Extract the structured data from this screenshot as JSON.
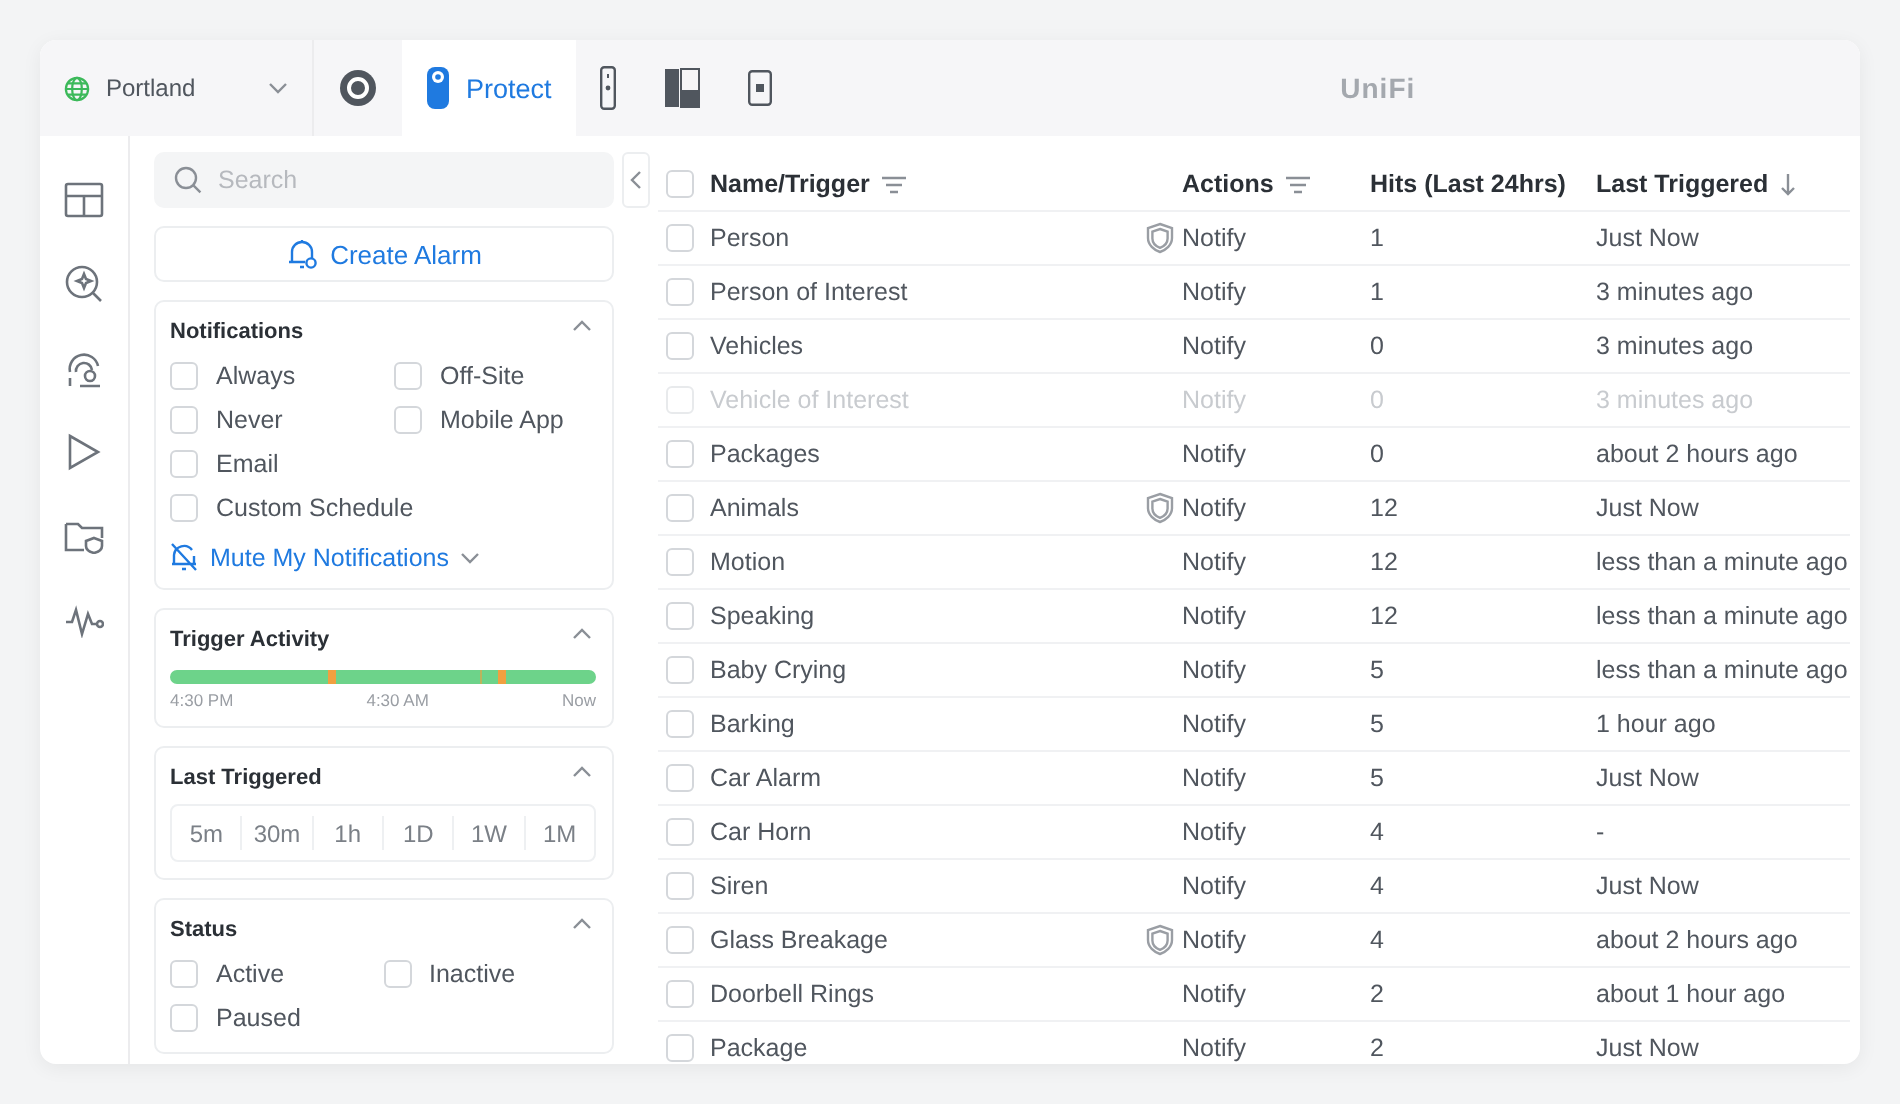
{
  "site_selector": {
    "label": "Portland"
  },
  "apps": [
    {
      "selected": false
    },
    {
      "label": "Protect",
      "selected": true
    },
    {
      "selected": false
    },
    {
      "selected": false
    },
    {
      "selected": false
    }
  ],
  "brand": "UniFi",
  "nav": [
    {
      "selected": false
    },
    {
      "selected": false
    },
    {
      "selected": false
    },
    {
      "selected": false
    },
    {
      "selected": false
    },
    {
      "selected": false
    }
  ],
  "filters": {
    "search": {
      "placeholder": "Search"
    },
    "create_button": "Create Alarm",
    "notifications": {
      "title": "Notifications",
      "expanded": true,
      "columns": [
        [
          {
            "label": "Always",
            "checked": false
          },
          {
            "label": "Never",
            "checked": false
          },
          {
            "label": "Email",
            "checked": false
          },
          {
            "label": "Custom Schedule",
            "checked": false
          }
        ],
        [
          {
            "label": "Off-Site",
            "checked": false
          },
          {
            "label": "Mobile App",
            "checked": false
          }
        ]
      ],
      "mute_link": "Mute My Notifications"
    },
    "trigger_activity": {
      "title": "Trigger Activity",
      "expanded": true,
      "labels": [
        "4:30 PM",
        "4:30 AM",
        "Now"
      ]
    },
    "last_triggered": {
      "title": "Last Triggered",
      "expanded": true,
      "options": [
        {
          "label": "5m",
          "selected": false
        },
        {
          "label": "30m",
          "selected": false
        },
        {
          "label": "1h",
          "selected": false
        },
        {
          "label": "1D",
          "selected": false
        },
        {
          "label": "1W",
          "selected": false
        },
        {
          "label": "1M",
          "selected": false
        }
      ]
    },
    "status": {
      "title": "Status",
      "expanded": true,
      "columns": [
        [
          {
            "label": "Active",
            "checked": false
          },
          {
            "label": "Paused",
            "checked": false
          }
        ],
        [
          {
            "label": "Inactive",
            "checked": false
          }
        ]
      ]
    }
  },
  "table": {
    "select_all_checked": false,
    "columns": [
      "Name/Trigger",
      "Actions",
      "Hits (Last 24hrs)",
      "Last Triggered"
    ],
    "rows": [
      {
        "name": "Person",
        "shield": true,
        "action": "Notify",
        "hits": "1",
        "last": "Just Now",
        "disabled": false,
        "checked": false
      },
      {
        "name": "Person of Interest",
        "shield": false,
        "action": "Notify",
        "hits": "1",
        "last": "3 minutes ago",
        "disabled": false,
        "checked": false
      },
      {
        "name": "Vehicles",
        "shield": false,
        "action": "Notify",
        "hits": "0",
        "last": "3 minutes ago",
        "disabled": false,
        "checked": false
      },
      {
        "name": "Vehicle of Interest",
        "shield": false,
        "action": "Notify",
        "hits": "0",
        "last": "3 minutes ago",
        "disabled": true,
        "checked": false
      },
      {
        "name": "Packages",
        "shield": false,
        "action": "Notify",
        "hits": "0",
        "last": "about 2 hours ago",
        "disabled": false,
        "checked": false
      },
      {
        "name": "Animals",
        "shield": true,
        "action": "Notify",
        "hits": "12",
        "last": "Just Now",
        "disabled": false,
        "checked": false
      },
      {
        "name": "Motion",
        "shield": false,
        "action": "Notify",
        "hits": "12",
        "last": "less than a minute ago",
        "disabled": false,
        "checked": false
      },
      {
        "name": "Speaking",
        "shield": false,
        "action": "Notify",
        "hits": "12",
        "last": "less than a minute ago",
        "disabled": false,
        "checked": false
      },
      {
        "name": "Baby Crying",
        "shield": false,
        "action": "Notify",
        "hits": "5",
        "last": "less than a minute ago",
        "disabled": false,
        "checked": false
      },
      {
        "name": "Barking",
        "shield": false,
        "action": "Notify",
        "hits": "5",
        "last": "1 hour ago",
        "disabled": false,
        "checked": false
      },
      {
        "name": "Car Alarm",
        "shield": false,
        "action": "Notify",
        "hits": "5",
        "last": "Just Now",
        "disabled": false,
        "checked": false
      },
      {
        "name": "Car Horn",
        "shield": false,
        "action": "Notify",
        "hits": "4",
        "last": "-",
        "disabled": false,
        "checked": false
      },
      {
        "name": "Siren",
        "shield": false,
        "action": "Notify",
        "hits": "4",
        "last": "Just Now",
        "disabled": false,
        "checked": false
      },
      {
        "name": "Glass Breakage",
        "shield": true,
        "action": "Notify",
        "hits": "4",
        "last": "about 2 hours ago",
        "disabled": false,
        "checked": false
      },
      {
        "name": "Doorbell Rings",
        "shield": false,
        "action": "Notify",
        "hits": "2",
        "last": "about 1 hour ago",
        "disabled": false,
        "checked": false
      },
      {
        "name": "Package",
        "shield": false,
        "action": "Notify",
        "hits": "2",
        "last": "Just Now",
        "disabled": false,
        "checked": false
      }
    ]
  }
}
